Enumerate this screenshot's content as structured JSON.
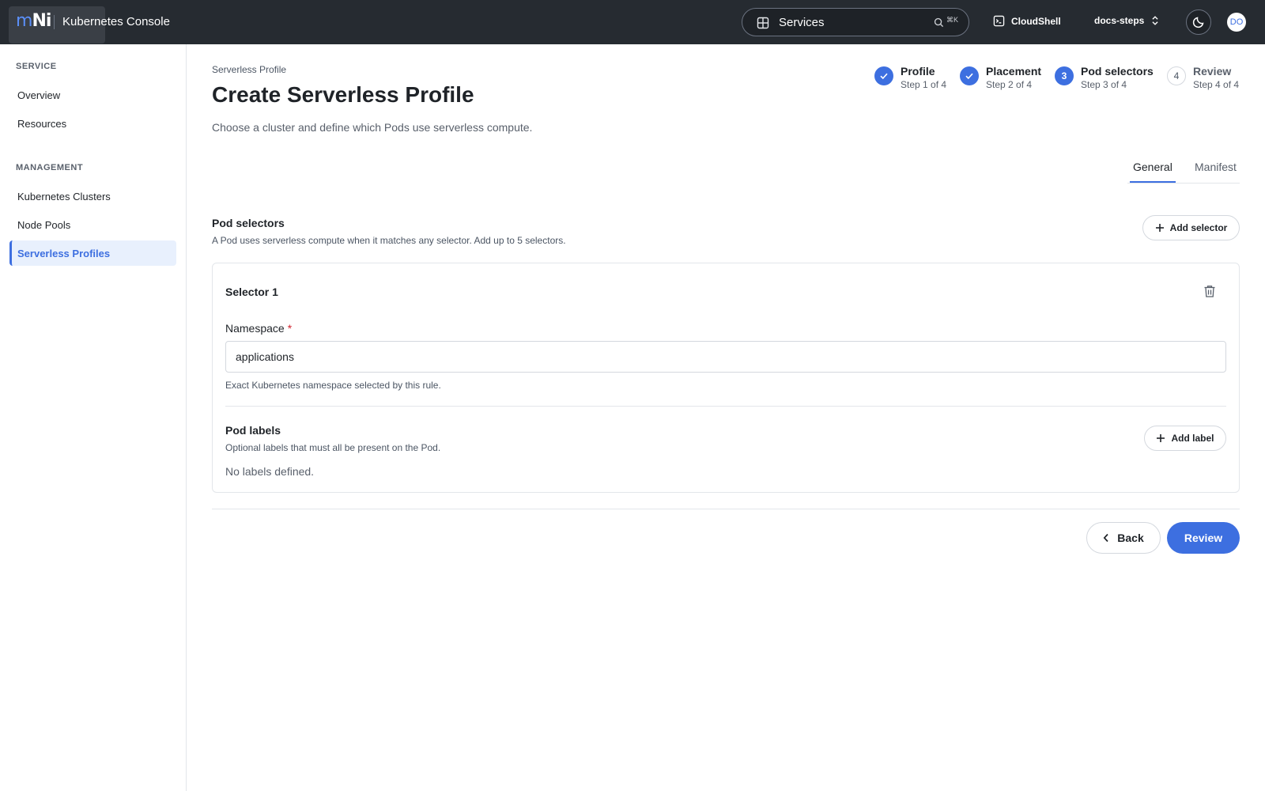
{
  "header": {
    "logo": {
      "m": "m",
      "ni": "Ni"
    },
    "app_title": "Kubernetes Console",
    "search": {
      "value": "Services",
      "shortcut": "⌘K"
    },
    "cloudshell_label": "CloudShell",
    "project_label": "docs-steps",
    "avatar_initials": "DO",
    "icons": [
      "grid-icon",
      "search-icon",
      "terminal-icon",
      "chevron-updown-icon",
      "moon-icon"
    ]
  },
  "sidebar": {
    "sections": [
      {
        "heading": "SERVICE",
        "items": [
          {
            "label": "Overview"
          },
          {
            "label": "Resources"
          }
        ]
      },
      {
        "heading": "MANAGEMENT",
        "items": [
          {
            "label": "Kubernetes Clusters"
          },
          {
            "label": "Node Pools"
          },
          {
            "label": "Serverless Profiles",
            "active": true
          }
        ]
      }
    ]
  },
  "page": {
    "breadcrumb": "Serverless Profile",
    "title": "Create Serverless Profile",
    "subtitle": "Choose a cluster and define which Pods use serverless compute."
  },
  "steps": [
    {
      "label": "Profile",
      "sub": "Step 1 of 4",
      "state": "done"
    },
    {
      "label": "Placement",
      "sub": "Step 2 of 4",
      "state": "done"
    },
    {
      "label": "Pod selectors",
      "sub": "Step 3 of 4",
      "state": "current",
      "number": "3"
    },
    {
      "label": "Review",
      "sub": "Step 4 of 4",
      "state": "todo",
      "number": "4"
    }
  ],
  "tabs": [
    {
      "label": "General",
      "active": true
    },
    {
      "label": "Manifest",
      "active": false
    }
  ],
  "pod_selectors": {
    "title": "Pod selectors",
    "description": "A Pod uses serverless compute when it matches any selector. Add up to 5 selectors.",
    "add_button": "Add selector"
  },
  "selector_card": {
    "title": "Selector 1",
    "namespace": {
      "label": "Namespace",
      "required_mark": "*",
      "value": "applications",
      "help": "Exact Kubernetes namespace selected by this rule."
    },
    "pod_labels": {
      "title": "Pod labels",
      "description": "Optional labels that must all be present on the Pod.",
      "add_button": "Add label",
      "empty_text": "No labels defined."
    }
  },
  "footer": {
    "back_label": "Back",
    "review_label": "Review"
  },
  "colors": {
    "accent": "#3d6fe0",
    "topbar": "#262b31",
    "active_bg": "#e8f0fd",
    "required": "#d1242f"
  }
}
